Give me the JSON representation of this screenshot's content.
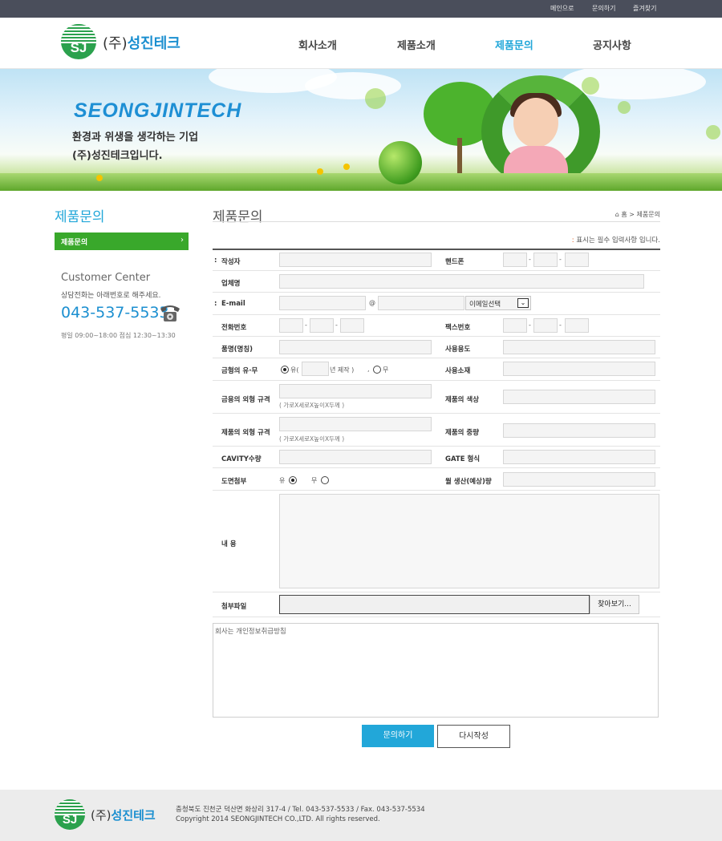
{
  "topbar": {
    "home": "메인으로",
    "contact": "문의하기",
    "favorite": "즐겨찾기"
  },
  "brand": {
    "paren": "(주)",
    "name": "성진테크",
    "logo_letters": "SJ",
    "accent": "#1b8fd0",
    "green": "#2ba14d"
  },
  "nav": [
    {
      "label": "회사소개"
    },
    {
      "label": "제품소개"
    },
    {
      "label": "제품문의"
    },
    {
      "label": "공지사항"
    }
  ],
  "banner": {
    "brand": "SEONGJINTECH",
    "line1": "환경과 위생을 생각하는 기업",
    "line2": "(주)성진테크입니다."
  },
  "sidebar": {
    "title": "제품문의",
    "menu_item": "제품문의",
    "cc_title": "Customer Center",
    "cc_desc": "상담전화는 아래번호로 해주세요.",
    "cc_phone": "043-537-5533",
    "cc_hours": "평일 09:00~18:00 점심 12:30~13:30"
  },
  "content": {
    "title": "제품문의",
    "breadcrumb": "홈 > 제품문의",
    "required_note": "표시는 필수 입력사항 입니다.",
    "accent": "#22a7d9"
  },
  "form": {
    "writer": "작성자",
    "mobile": "핸드폰",
    "company": "업체명",
    "email": "E-mail",
    "email_at": "@",
    "email_select": "이메일선택",
    "phone": "전화번호",
    "fax": "팩스번호",
    "product_name": "품명(명칭)",
    "usage": "사용용도",
    "mold_exist": "금형의 유·무",
    "mold_yes": "유(",
    "mold_year": "년 제작 )",
    "mold_no": "무",
    "material": "사용소재",
    "mold_size": "금용의 외형 규격",
    "size_hint": "( 가로X세로X높이X두께 )",
    "product_color": "제품의 색상",
    "product_size": "제품의 외형 규격",
    "product_weight": "제품의 중량",
    "cavity": "CAVITY수량",
    "gate": "GATE 형식",
    "drawing": "도면첨부",
    "drawing_yes": "유",
    "drawing_no": "무",
    "monthly": "월 생산(예상)량",
    "content": "내 용",
    "file": "첨부파일",
    "browse": "찾아보기...",
    "privacy": "회사는 개인정보취급방침",
    "submit": "문의하기",
    "reset": "다시작성",
    "dash": "-"
  },
  "footer": {
    "address": "충청북도 진천군 덕산면 화상리 317-4 / Tel. 043-537-5533 / Fax. 043-537-5534",
    "copyright": "Copyright 2014 SEONGJINTECH CO.,LTD. All rights reserved."
  }
}
